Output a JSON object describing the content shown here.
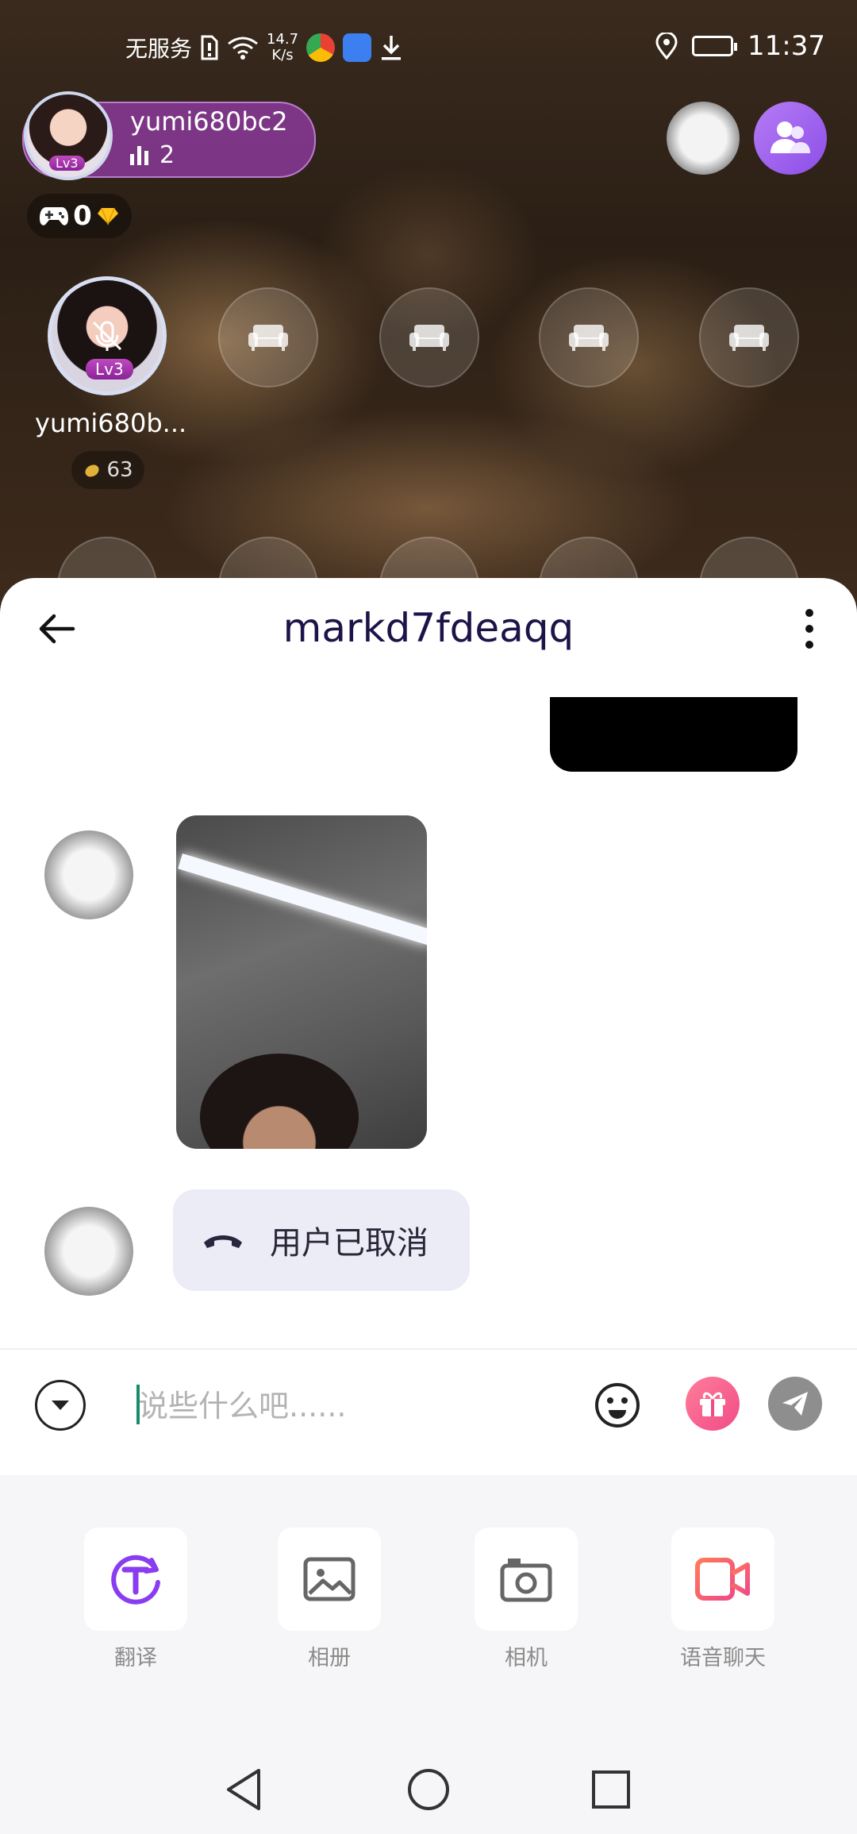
{
  "status_bar": {
    "carrier": "无服务",
    "speed_value": "14.7",
    "speed_unit": "K/s",
    "time": "11:37"
  },
  "room": {
    "host_name": "yumi680bc2",
    "host_count": "2",
    "host_level": "Lv3",
    "gem_count": "0",
    "seat_host_name": "yumi680b...",
    "seat_host_level": "Lv3",
    "seat_host_score": "63",
    "empty_seat_count": 4
  },
  "chat": {
    "title": "markd7fdeaqq",
    "call_status": "用户已取消"
  },
  "input": {
    "placeholder": "说些什么吧......"
  },
  "tools": [
    {
      "label": "翻译",
      "icon": "translate-icon"
    },
    {
      "label": "相册",
      "icon": "album-icon"
    },
    {
      "label": "相机",
      "icon": "camera-icon"
    },
    {
      "label": "语音聊天",
      "icon": "video-chat-icon"
    }
  ],
  "colors": {
    "accent_purple": "#8c4ee8",
    "title_navy": "#1e1348",
    "gift_pink": "#f04b86",
    "video_orange": "#ff7a59"
  }
}
